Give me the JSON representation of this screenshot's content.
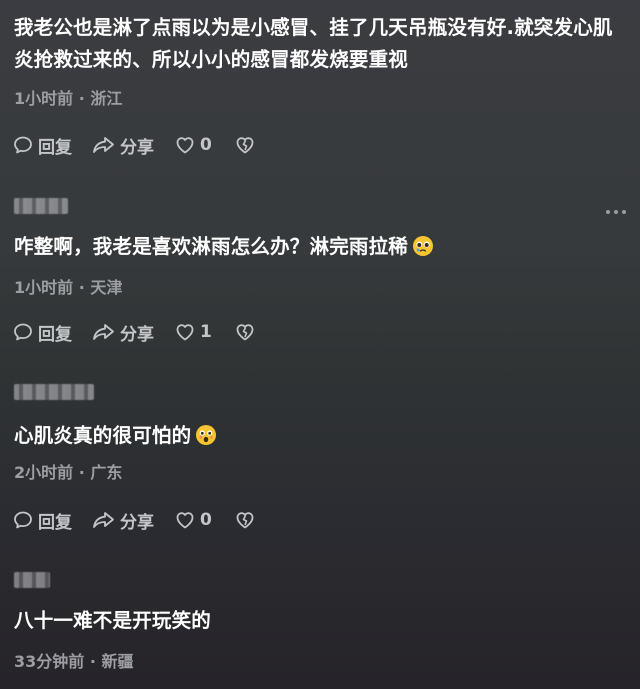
{
  "comments": [
    {
      "text": "我老公也是淋了点雨以为是小感冒、挂了几天吊瓶没有好.就突发心肌炎抢救过来的、所以小小的感冒都发烧要重视",
      "time": "1小时前",
      "location": "浙江",
      "like_count": "0",
      "emoji": null
    },
    {
      "text": "咋整啊，我老是喜欢淋雨怎么办？淋完雨拉稀",
      "time": "1小时前",
      "location": "天津",
      "like_count": "1",
      "emoji": "pleading-face-icon"
    },
    {
      "text": "心肌炎真的很可怕的",
      "time": "2小时前",
      "location": "广东",
      "like_count": "0",
      "emoji": "fearful-face-icon"
    },
    {
      "text": "八十一难不是开玩笑的",
      "time": "33分钟前",
      "location": "新疆",
      "like_count": null,
      "emoji": null
    }
  ],
  "labels": {
    "reply": "回复",
    "share": "分享",
    "separator": "·"
  },
  "colors": {
    "text_primary": "#ffffff",
    "text_meta": "#9c9ea3",
    "action": "#c3c5c9",
    "emoji_face": "#f7c531"
  }
}
